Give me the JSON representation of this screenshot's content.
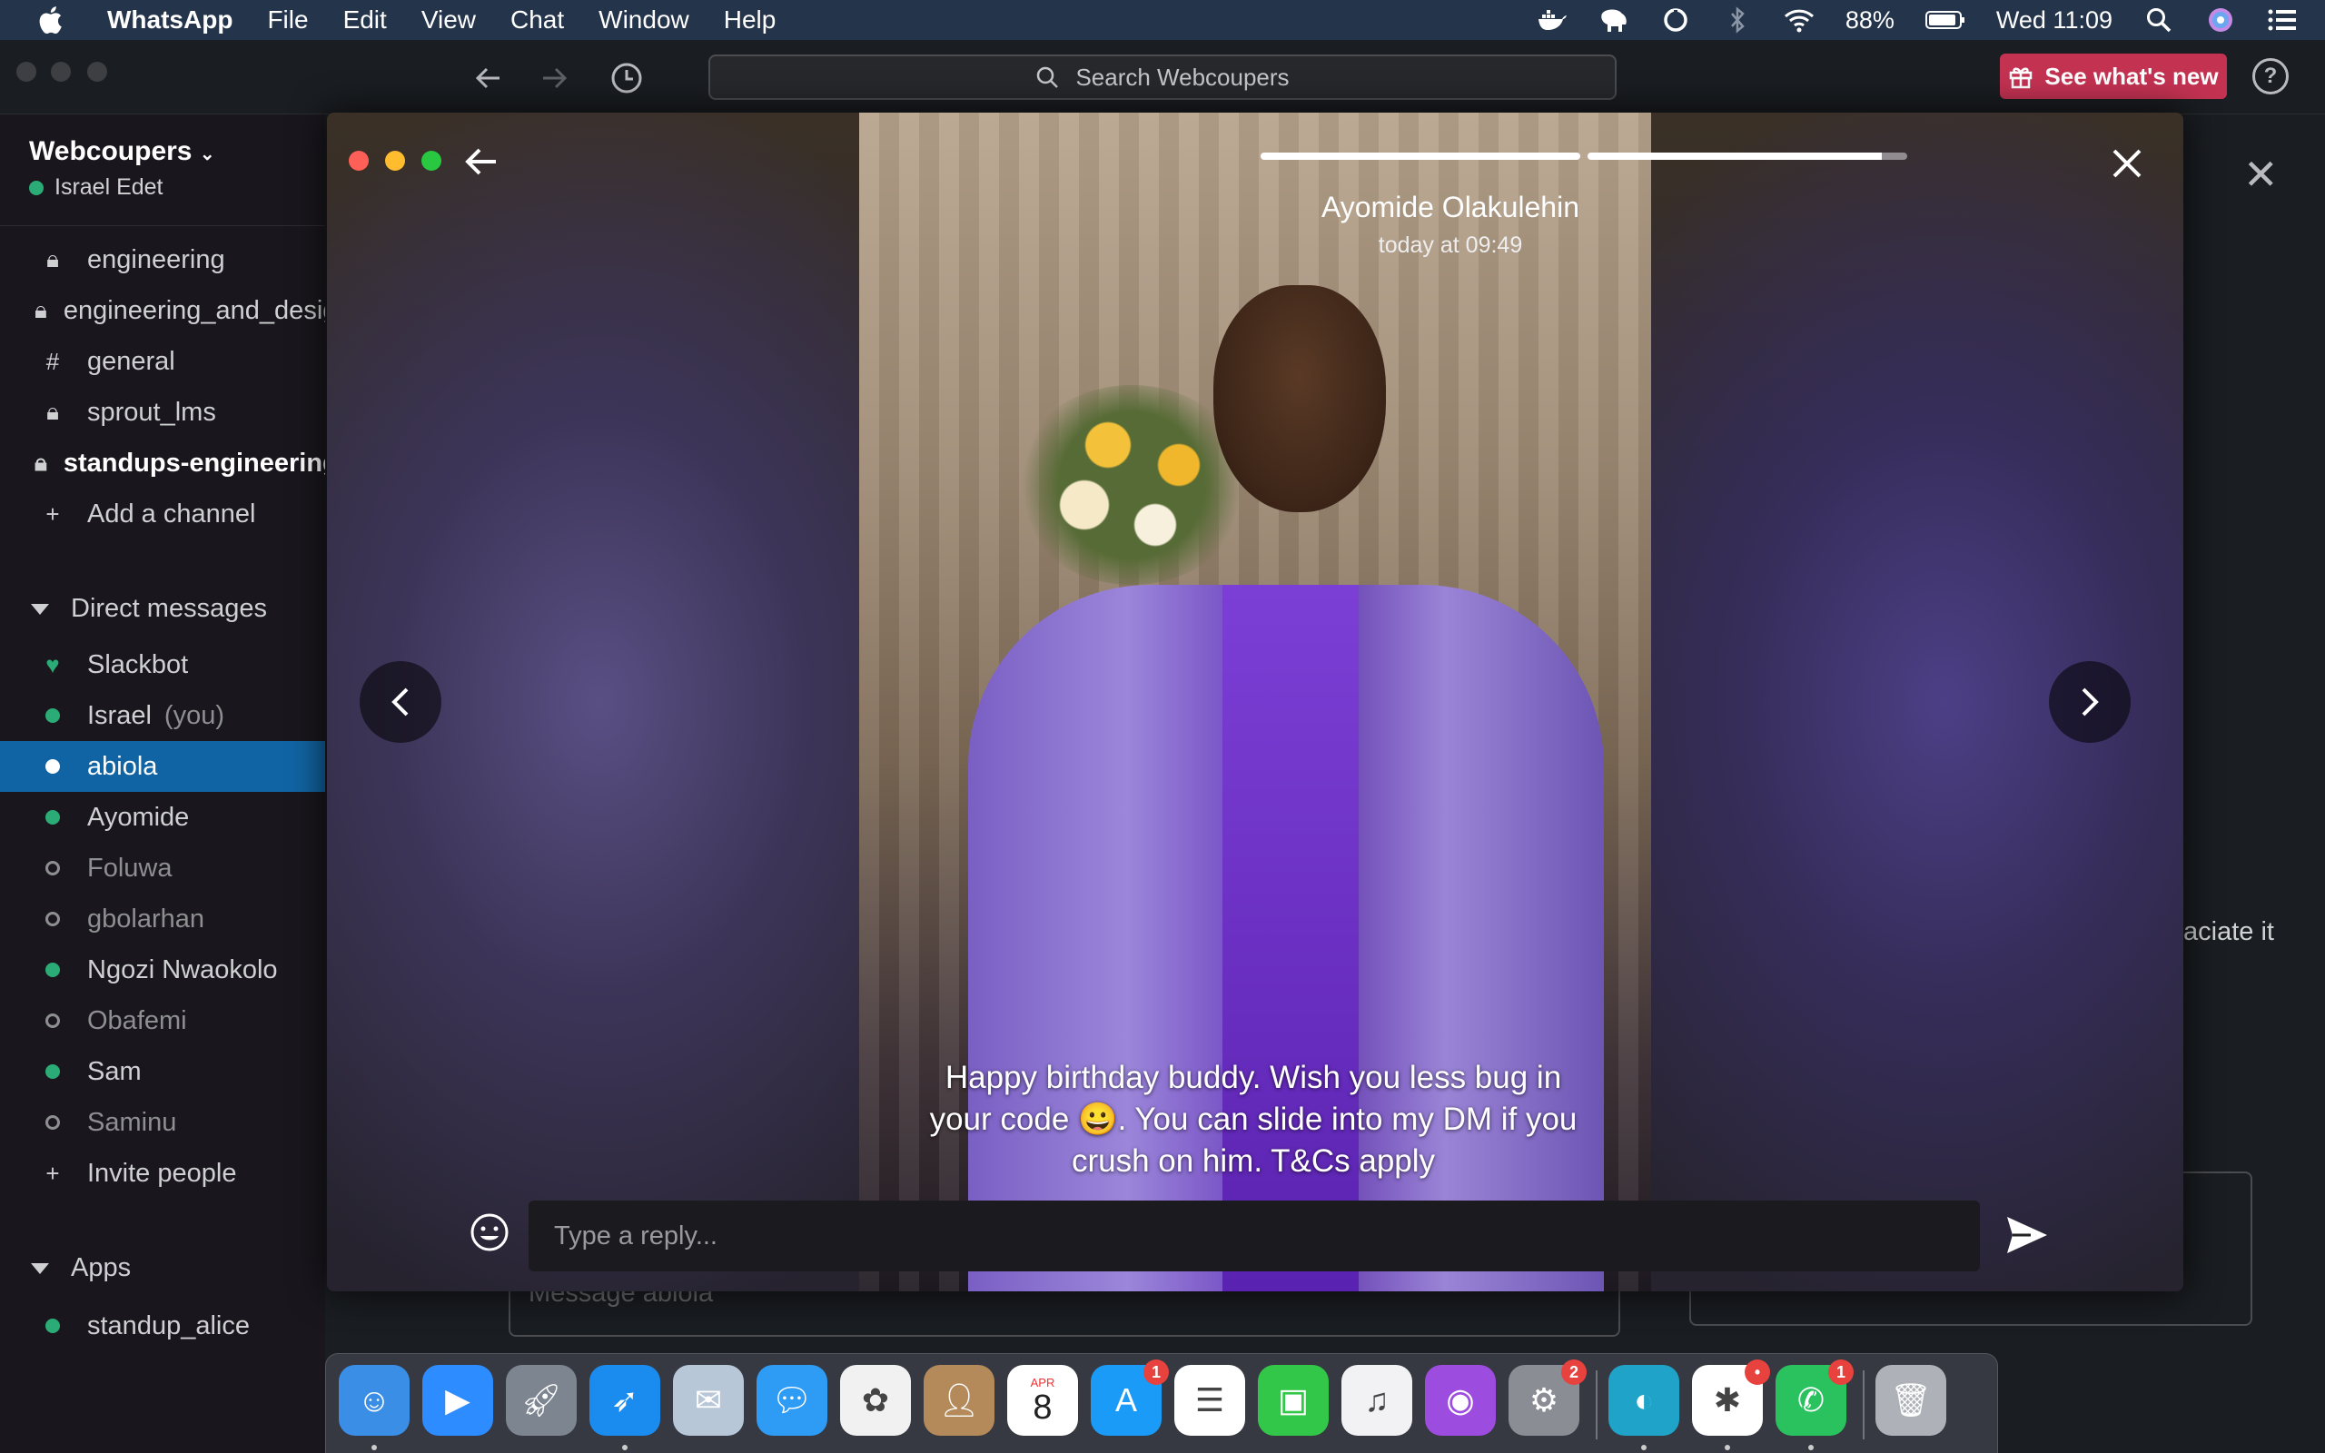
{
  "menubar": {
    "app_name": "WhatsApp",
    "menus": [
      "File",
      "Edit",
      "View",
      "Chat",
      "Window",
      "Help"
    ],
    "battery": "88%",
    "clock": "Wed 11:09"
  },
  "toolbar": {
    "search_placeholder": "Search Webcoupers",
    "whats_new_label": "See what's new",
    "help_label": "?"
  },
  "sidebar": {
    "workspace_name": "Webcoupers",
    "current_user": "Israel Edet",
    "channels": [
      {
        "name": "engineering",
        "icon": "lock-icon"
      },
      {
        "name": "engineering_and_design",
        "icon": "lock-icon"
      },
      {
        "name": "general",
        "icon": "hash-icon"
      },
      {
        "name": "sprout_lms",
        "icon": "lock-icon"
      },
      {
        "name": "standups-engineering",
        "icon": "lock-icon",
        "unread": true
      }
    ],
    "add_channel_label": "Add a channel",
    "dm_section_label": "Direct messages",
    "dms": [
      {
        "name": "Slackbot",
        "status": "bot"
      },
      {
        "name": "Israel",
        "suffix": "(you)",
        "status": "online"
      },
      {
        "name": "abiola",
        "status": "online",
        "active": true
      },
      {
        "name": "Ayomide",
        "status": "online"
      },
      {
        "name": "Foluwa",
        "status": "offline"
      },
      {
        "name": "gbolarhan",
        "status": "offline"
      },
      {
        "name": "Ngozi Nwaokolo",
        "status": "online"
      },
      {
        "name": "Obafemi",
        "status": "offline"
      },
      {
        "name": "Sam",
        "status": "online"
      },
      {
        "name": "Saminu",
        "status": "offline"
      }
    ],
    "invite_label": "Invite people",
    "apps_section_label": "Apps",
    "apps": [
      {
        "name": "standup_alice",
        "status": "online"
      }
    ]
  },
  "background": {
    "composer_placeholder": "Message abiola",
    "visible_text_fragment": "aciate it"
  },
  "story": {
    "author": "Ayomide Olakulehin",
    "timestamp": "today at 09:49",
    "progress": [
      1.0,
      0.92
    ],
    "caption_line1": "Happy birthday buddy. Wish you less bug in",
    "caption_line2": "your code 😀. You can slide into my DM if you",
    "caption_line3": "crush on him. T&Cs apply",
    "reply_placeholder": "Type a reply..."
  },
  "dock": {
    "apps": [
      {
        "name": "Finder",
        "icon": "finder-icon",
        "color": "#3a8ee6",
        "running": true
      },
      {
        "name": "Zoom",
        "icon": "zoom-icon",
        "color": "#2d8cff"
      },
      {
        "name": "Launchpad",
        "icon": "rocket-icon",
        "color": "#7d8591"
      },
      {
        "name": "Safari",
        "icon": "compass-icon",
        "color": "#1a8cf0",
        "running": true
      },
      {
        "name": "Mail Stamp",
        "icon": "stamp-icon",
        "color": "#b8c7d8"
      },
      {
        "name": "Messages",
        "icon": "messages-icon",
        "color": "#2e9bf5"
      },
      {
        "name": "Photos",
        "icon": "photos-icon",
        "color": "#f1f1f1"
      },
      {
        "name": "Contacts",
        "icon": "contacts-icon",
        "color": "#b48a5a"
      },
      {
        "name": "Calendar",
        "icon": "calendar-icon",
        "color": "#ffffff",
        "month": "APR",
        "day": "8"
      },
      {
        "name": "App Store",
        "icon": "app-store-icon",
        "color": "#1a9bf7",
        "badge": "1"
      },
      {
        "name": "Reminders",
        "icon": "reminders-icon",
        "color": "#ffffff"
      },
      {
        "name": "FaceTime",
        "icon": "facetime-icon",
        "color": "#33c74a"
      },
      {
        "name": "Music",
        "icon": "music-icon",
        "color": "#f2f2f4"
      },
      {
        "name": "Podcasts",
        "icon": "podcasts-icon",
        "color": "#9d4ce0"
      },
      {
        "name": "System Preferences",
        "icon": "gear-icon",
        "color": "#8a8d93",
        "badge": "2"
      },
      {
        "name": "Edge",
        "icon": "edge-icon",
        "color": "#1fa3c8",
        "running": true
      },
      {
        "name": "Slack",
        "icon": "slack-icon",
        "color": "#ffffff",
        "badge": "•",
        "running": true
      },
      {
        "name": "WhatsApp",
        "icon": "whatsapp-icon",
        "color": "#29c25e",
        "badge": "1",
        "running": true
      },
      {
        "name": "Trash",
        "icon": "trash-icon",
        "color": "#aeb2b8"
      }
    ]
  }
}
